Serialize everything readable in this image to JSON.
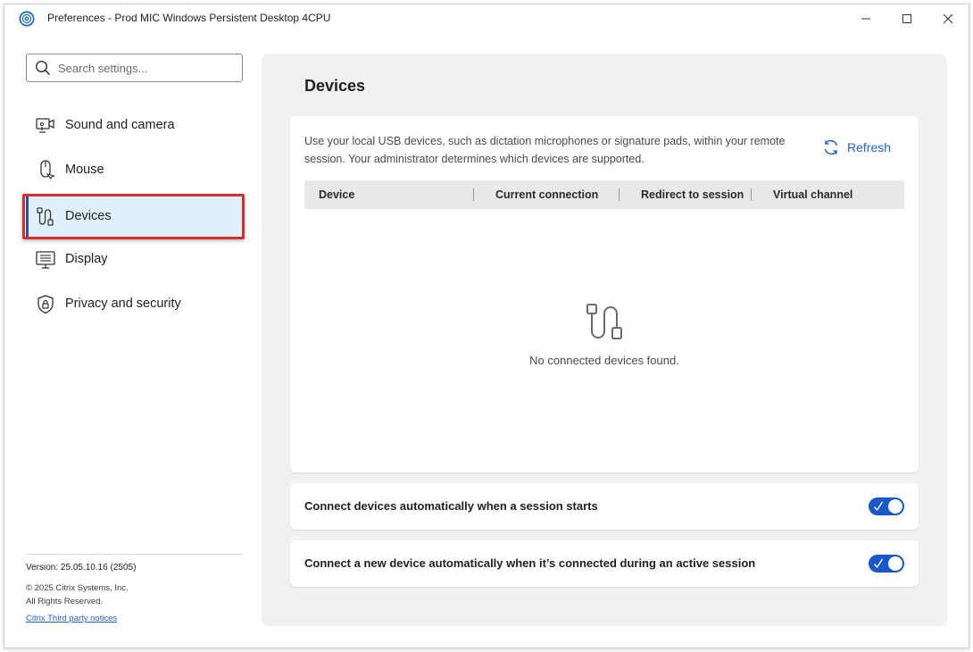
{
  "window": {
    "title": "Preferences - Prod MIC Windows Persistent Desktop 4CPU",
    "app_icon": "citrix-logo-icon",
    "controls": [
      "minimize-icon",
      "maximize-icon",
      "close-icon"
    ]
  },
  "search": {
    "placeholder": "Search settings...",
    "value": "",
    "icon": "search-icon"
  },
  "sidebar": {
    "items": [
      {
        "label": "Sound and camera",
        "icon": "sound-camera-icon",
        "active": false
      },
      {
        "label": "Mouse",
        "icon": "mouse-icon",
        "active": false
      },
      {
        "label": "Devices",
        "icon": "usb-devices-icon",
        "active": true
      },
      {
        "label": "Display",
        "icon": "display-icon",
        "active": false
      },
      {
        "label": "Privacy and security",
        "icon": "shield-lock-icon",
        "active": false
      }
    ],
    "version": "Version: 25.05.10.16 (2505)",
    "copyright_line1": "© 2025 Citrix Systems, Inc.",
    "copyright_line2": "All Rights Reserved.",
    "notices_link": "Citrix Third party notices"
  },
  "main": {
    "title": "Devices",
    "description": "Use your local USB devices, such as dictation microphones or signature pads, within your remote session. Your administrator determines which devices are supported.",
    "refresh_label": "Refresh",
    "table": {
      "columns": [
        "Device",
        "Current connection",
        "Redirect to session",
        "Virtual channel"
      ],
      "rows": []
    },
    "empty_message": "No connected devices found.",
    "toggles": [
      {
        "label": "Connect devices automatically when a session starts",
        "on": true
      },
      {
        "label": "Connect a new device automatically when it’s connected during an active session",
        "on": true
      }
    ]
  },
  "colors": {
    "accent": "#1658c9",
    "link": "#2563c8",
    "active_nav_bg": "#e1f1fb",
    "active_nav_bar": "#2f4ea3",
    "highlight_box": "#d32f2f",
    "panel_bg": "#f1f1f1"
  }
}
